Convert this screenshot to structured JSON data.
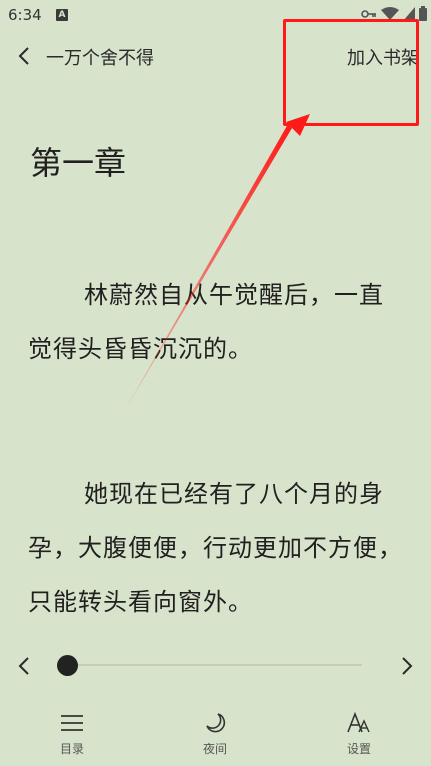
{
  "status_bar": {
    "time": "6:34",
    "app_icon_letter": "A"
  },
  "top_bar": {
    "book_title": "一万个舍不得",
    "add_to_shelf_label": "加入书架"
  },
  "content": {
    "chapter_title": "第一章",
    "paragraphs": [
      "林蔚然自从午觉醒后，一直觉得头昏昏沉沉的。",
      "她现在已经有了八个月的身孕，大腹便便，行动更加不方便，只能转头看向窗外。"
    ]
  },
  "progress": {
    "value": 0
  },
  "bottom_bar": {
    "toc_label": "目录",
    "night_label": "夜间",
    "settings_label": "设置"
  },
  "colors": {
    "background": "#d8e3cb",
    "annotation": "#ff1a1a"
  }
}
